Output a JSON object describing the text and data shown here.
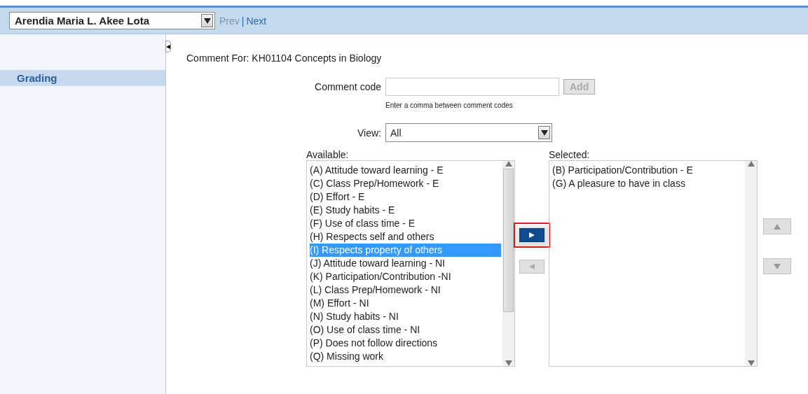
{
  "header": {
    "student_select": {
      "value": "Arendia Maria L. Akee Lota"
    },
    "nav_links": [
      {
        "label": "Prev",
        "disabled": true
      },
      {
        "label": "Next",
        "disabled": false
      }
    ],
    "nav_separator": "|"
  },
  "sidebar": {
    "items": [
      {
        "label": "Grading",
        "selected": true
      }
    ]
  },
  "title": "Comment For: KH01104 Concepts in Biology",
  "comment_code": {
    "label": "Comment code",
    "add_button": {
      "label": "Add",
      "disabled": true
    },
    "hint": "Enter a comma between comment codes"
  },
  "view": {
    "label": "View:",
    "value": "All"
  },
  "available": {
    "label": "Available:",
    "items": [
      {
        "label": "(A) Attitude toward learning - E",
        "selected": false
      },
      {
        "label": "(C) Class Prep/Homework - E",
        "selected": false
      },
      {
        "label": "(D) Effort - E",
        "selected": false
      },
      {
        "label": "(E) Study habits - E",
        "selected": false
      },
      {
        "label": "(F) Use of class time - E",
        "selected": false
      },
      {
        "label": "(H) Respects self and others",
        "selected": false
      },
      {
        "label": "(I) Respects property of others",
        "selected": true
      },
      {
        "label": "(J) Attitude toward learning - NI",
        "selected": false
      },
      {
        "label": "(K) Participation/Contribution -NI",
        "selected": false
      },
      {
        "label": "(L) Class Prep/Homework - NI",
        "selected": false
      },
      {
        "label": "(M) Effort - NI",
        "selected": false
      },
      {
        "label": "(N) Study habits - NI",
        "selected": false
      },
      {
        "label": "(O) Use of class time - NI",
        "selected": false
      },
      {
        "label": "(P) Does not follow directions",
        "selected": false
      },
      {
        "label": "(Q) Missing work",
        "selected": false
      }
    ]
  },
  "move_buttons": [
    {
      "kind": "right",
      "disabled": false,
      "highlighted": true
    },
    {
      "kind": "left",
      "disabled": true,
      "highlighted": false
    }
  ],
  "selected": {
    "label": "Selected:",
    "items": [
      {
        "label": "(B) Participation/Contribution - E",
        "selected": false
      },
      {
        "label": "(G) A pleasure to have in class",
        "selected": false
      }
    ]
  },
  "order_buttons": [
    {
      "kind": "up",
      "disabled": true
    },
    {
      "kind": "down",
      "disabled": true
    }
  ]
}
